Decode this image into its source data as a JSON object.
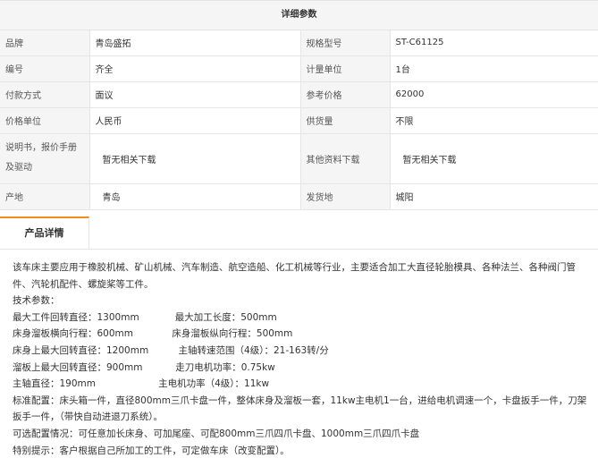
{
  "spec": {
    "header": "详细参数",
    "rows": [
      {
        "l1": "品牌",
        "v1": "青岛盛拓",
        "l2": "规格型号",
        "v2": "ST-C61125"
      },
      {
        "l1": "编号",
        "v1": "齐全",
        "l2": "计量单位",
        "v2": "1台"
      },
      {
        "l1": "付款方式",
        "v1": "面议",
        "l2": "参考价格",
        "v2": "62000"
      },
      {
        "l1": "价格单位",
        "v1": "人民币",
        "l2": "供货量",
        "v2": "不限"
      },
      {
        "l1": "说明书，报价手册及驱动",
        "v1": "暂无相关下载",
        "l2": "其他资料下载",
        "v2": "暂无相关下载"
      },
      {
        "l1": "产地",
        "v1": "青岛",
        "l2": "发货地",
        "v2": "城阳"
      }
    ]
  },
  "tabs": {
    "active": "产品详情"
  },
  "description": [
    "该车床主要应用于橡胶机械、矿山机械、汽车制造、航空造船、化工机械等行业，主要适合加工大直径轮胎模具、各种法兰、各种阀门管件、汽轮机配件、螺旋桨等工件。",
    "技术参数：",
    "最大工件回转直径：1300mm            最大加工长度：500mm",
    "床身溜板横向行程：600mm             床身溜板纵向行程：500mm",
    "床身上最大回转直径：1200mm          主轴转速范围（4级）：21-163转/分",
    "溜板上最大回转直径：900mm           走刀电机功率：0.75kw",
    "主轴直径：190mm                     主电机功率（4级）：11kw",
    "标准配置：床头箱一件，直径800mm三爪卡盘一件，整体床身及溜板一套，11kw主电机1一台，进给电机调速一个，卡盘扳手一件，刀架扳手一件，（带快自动进退刀系统）。",
    "可选配置情况：可任意加长床身、可加尾座、可配800mm三爪四爪卡盘、1000mm三爪四爪卡盘",
    "特别提示：客户根据自己所加工的工件，可定做车床（改变配置）。"
  ]
}
